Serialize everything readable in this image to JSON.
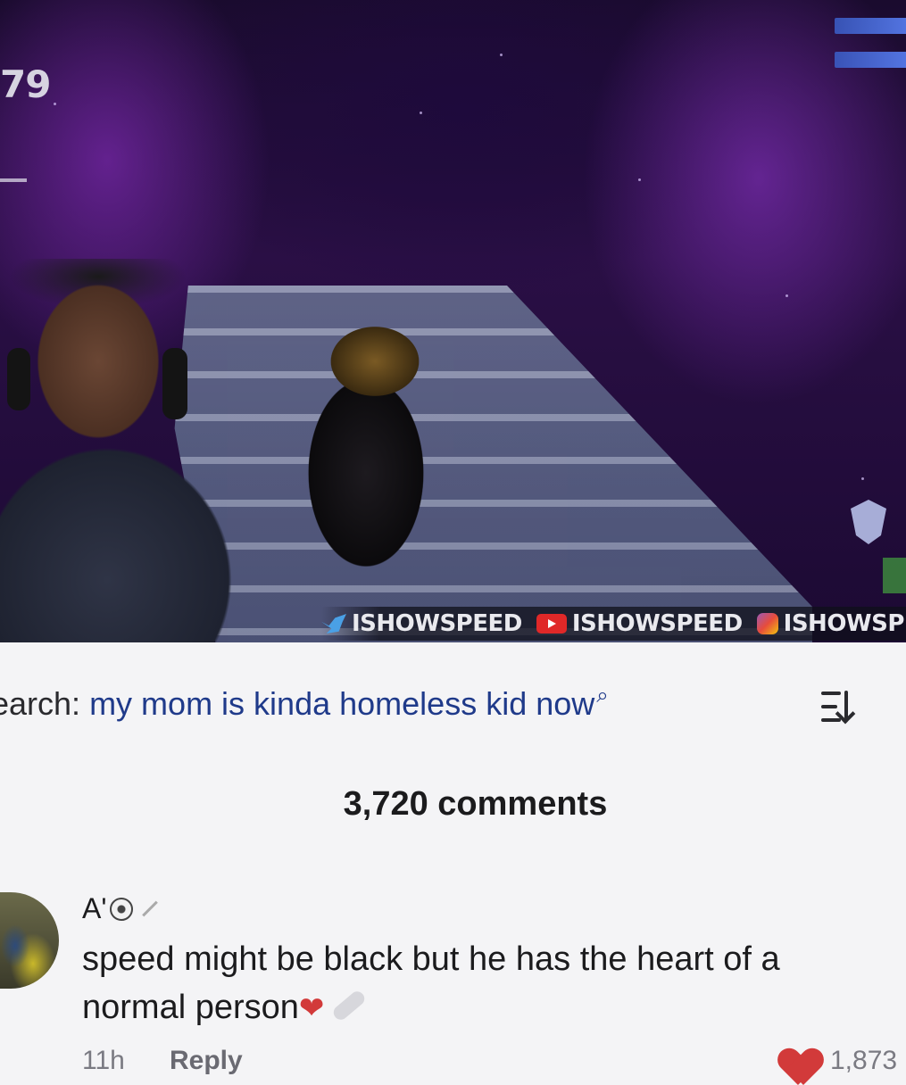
{
  "video": {
    "hud_counter": "79",
    "ticker": [
      {
        "platform": "twitter-icon",
        "handle": "ISHOWSPEED"
      },
      {
        "platform": "youtube-icon",
        "handle": "ISHOWSPEED"
      },
      {
        "platform": "instagram-icon",
        "handle": "ISHOWSPEE"
      }
    ]
  },
  "search": {
    "label": "earch:",
    "query": "my mom is kinda homeless kid now",
    "icon": "search-icon"
  },
  "sort": {
    "icon": "sort-icon"
  },
  "comments": {
    "count_label": "3,720 comments",
    "items": [
      {
        "username": "A'",
        "username_icons": [
          "soccer-ball-icon",
          "magic-wand-icon"
        ],
        "text_line1": "speed might be black but he has the heart of a",
        "text_line2": "normal person",
        "trailing_icons": [
          "red-heart-icon",
          "bandage-icon"
        ],
        "time": "11h",
        "reply_label": "Reply",
        "likes": "1,873"
      }
    ]
  },
  "colors": {
    "query": "#1f3a8a",
    "like_heart": "#d23a3a",
    "panel_bg": "#f4f4f6"
  }
}
